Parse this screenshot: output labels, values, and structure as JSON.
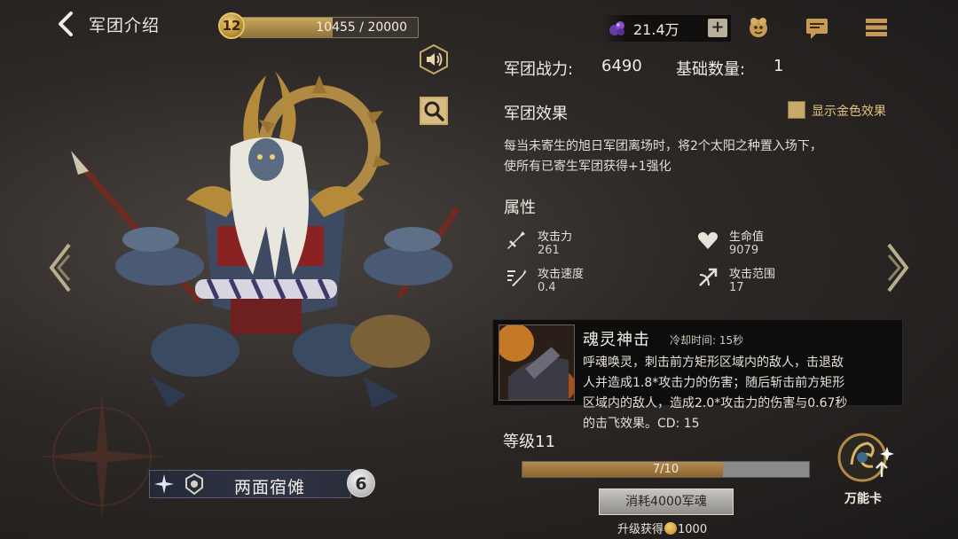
{
  "header": {
    "back_icon": "chevron-left-icon",
    "title": "军团介绍",
    "player_level": "12",
    "xp_text": "10455 / 20000",
    "xp_progress": 0.52
  },
  "currency": {
    "icon": "purple-gem-icon",
    "amount": "21.4万",
    "plus_label": "+"
  },
  "top_icons": [
    "pet-icon",
    "chat-icon",
    "menu-icon"
  ],
  "side_buttons": [
    "speaker-icon",
    "magnifier-icon"
  ],
  "unit": {
    "name": "两面宿傩",
    "count": "6"
  },
  "stats": {
    "power_label": "军团战力:",
    "power_value": "6490",
    "base_count_label": "基础数量:",
    "base_count_value": "1"
  },
  "effect": {
    "title": "军团效果",
    "toggle_label": "显示金色效果",
    "line1": "每当未寄生的旭日军团离场时，将2个太阳之种置入场下，",
    "line2": "使所有已寄生军团获得+1强化"
  },
  "attributes": {
    "title": "属性",
    "items": [
      {
        "icon": "sword-icon",
        "label": "攻击力",
        "value": "261"
      },
      {
        "icon": "heart-icon",
        "label": "生命值",
        "value": "9079"
      },
      {
        "icon": "speed-icon",
        "label": "攻击速度",
        "value": "0.4"
      },
      {
        "icon": "bow-icon",
        "label": "攻击范围",
        "value": "17"
      }
    ]
  },
  "skill": {
    "name": "魂灵神击",
    "cooldown": "冷却时间: 15秒",
    "line1": "呼魂唤灵，刺击前方矩形区域内的敌人，击退敌",
    "line2": "人并造成1.8*攻击力的伤害；随后斩击前方矩形",
    "line3": "区域内的敌人，造成2.0*攻击力的伤害与0.67秒",
    "line4": "的击飞效果。CD: 15"
  },
  "level": {
    "label": "等级11",
    "progress_text": "7/10",
    "progress": 0.7,
    "upgrade_button": "消耗4000军魂",
    "reward_prefix": "升级获得",
    "reward_amount": "1000"
  },
  "wild_card": {
    "label": "万能卡"
  },
  "colors": {
    "gold": "#c9a96a",
    "accent_text": "#e5c27e",
    "background": "#2c2826"
  }
}
